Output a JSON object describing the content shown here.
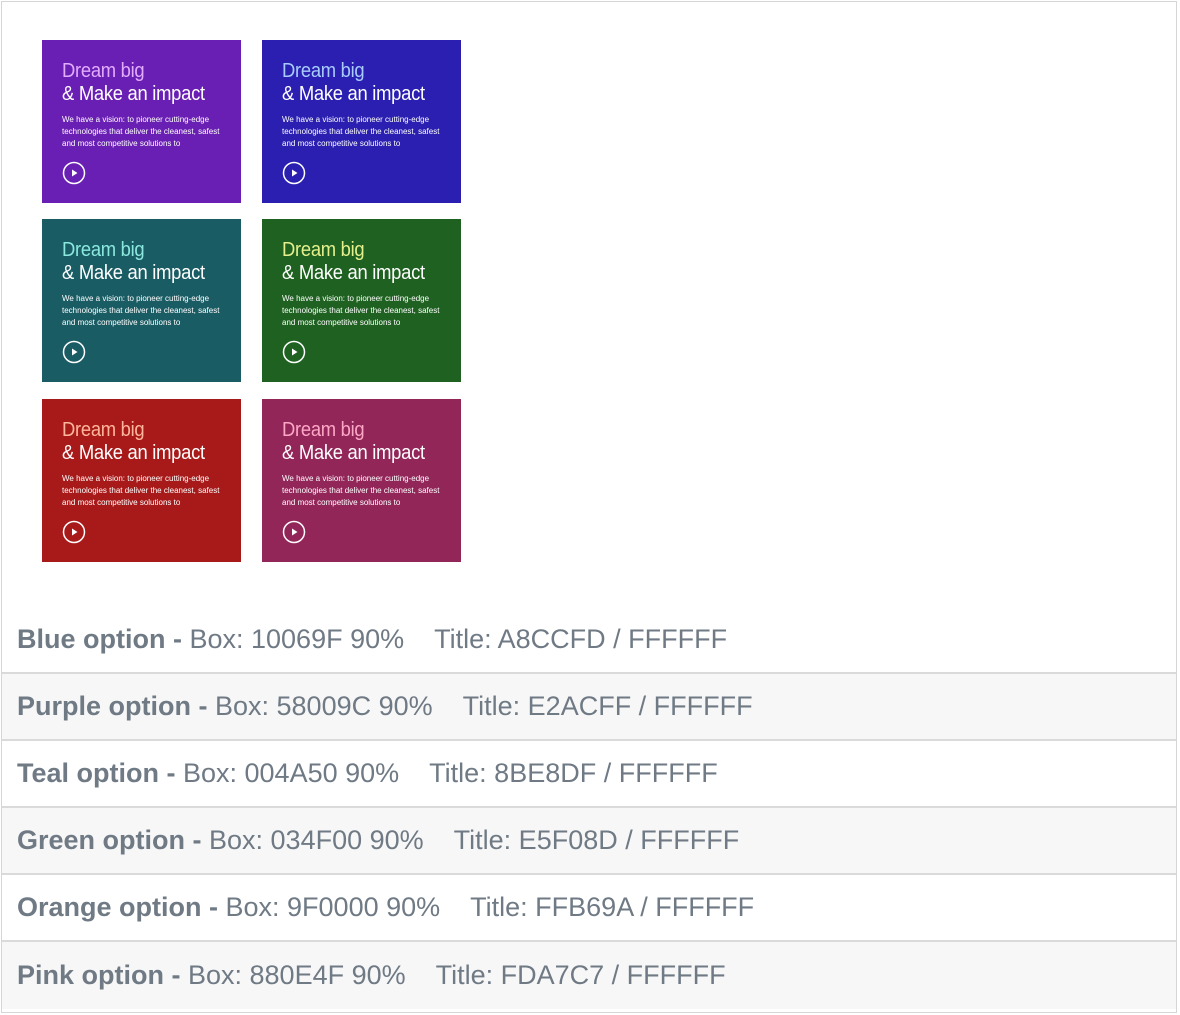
{
  "card_text": {
    "title_line1": "Dream big",
    "title_line2": "& Make an impact",
    "description": "We have a vision: to pioneer cutting-edge technologies that deliver the cleanest, safest and most competitive solutions to"
  },
  "cards": [
    {
      "bg": "#6a1fb4",
      "accent": "#e2acff"
    },
    {
      "bg": "#2a1fb0",
      "accent": "#a8ccfd"
    },
    {
      "bg": "#1a5c64",
      "accent": "#8be8df"
    },
    {
      "bg": "#1e6120",
      "accent": "#e5f08d"
    },
    {
      "bg": "#a81a1a",
      "accent": "#ffb69a"
    },
    {
      "bg": "#922659",
      "accent": "#fda7c7"
    }
  ],
  "options": [
    {
      "name": "Blue option -",
      "box": "Box: 10069F 90%",
      "title": "Title: A8CCFD / FFFFFF"
    },
    {
      "name": "Purple option -",
      "box": "Box: 58009C 90%",
      "title": "Title: E2ACFF / FFFFFF"
    },
    {
      "name": "Teal option -",
      "box": "Box: 004A50 90%",
      "title": "Title: 8BE8DF / FFFFFF"
    },
    {
      "name": "Green option -",
      "box": "Box: 034F00 90%",
      "title": "Title: E5F08D / FFFFFF"
    },
    {
      "name": "Orange option -",
      "box": "Box: 9F0000 90%",
      "title": "Title: FFB69A / FFFFFF"
    },
    {
      "name": "Pink option -",
      "box": "Box: 880E4F 90%",
      "title": "Title: FDA7C7 / FFFFFF"
    }
  ]
}
